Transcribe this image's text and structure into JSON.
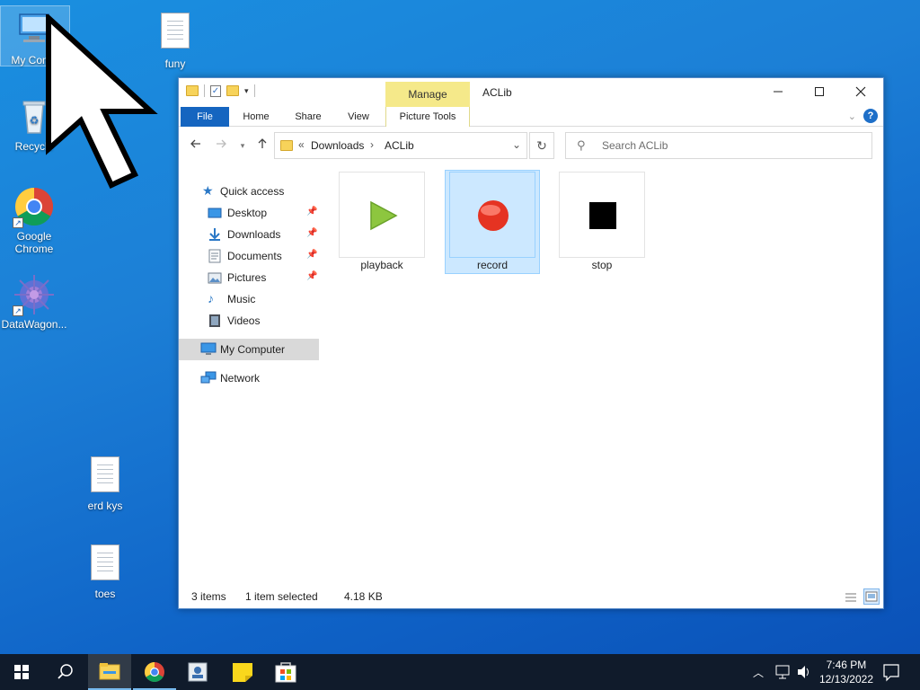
{
  "desktop": {
    "icons": [
      {
        "label": "My Computer",
        "display": "My Comp",
        "glyph": "computer-icon"
      },
      {
        "label": "funy",
        "glyph": "text-file-icon"
      },
      {
        "label": "Recycle Bin",
        "display": "Recycle",
        "glyph": "recycle-bin-icon"
      },
      {
        "label": "Google Chrome",
        "line1": "Google",
        "line2": "Chrome",
        "glyph": "chrome-icon"
      },
      {
        "label": "DataWagon...",
        "glyph": "datawagon-icon"
      },
      {
        "label": "erd kys",
        "glyph": "text-file-icon"
      },
      {
        "label": "toes",
        "glyph": "text-file-icon"
      }
    ]
  },
  "window": {
    "title": "ACLib",
    "manage_label": "Manage",
    "controls": {
      "minimize": "—",
      "maximize": "☐",
      "close": "✕"
    },
    "ribbon_tabs": [
      "File",
      "Home",
      "Share",
      "View",
      "Picture Tools"
    ],
    "address": {
      "prefix": "«",
      "crumbs": [
        "Downloads",
        "ACLib"
      ]
    },
    "search_placeholder": "Search ACLib",
    "nav_pane": {
      "quick_access": "Quick access",
      "items": [
        "Desktop",
        "Downloads",
        "Documents",
        "Pictures",
        "Music",
        "Videos"
      ],
      "my_computer": "My Computer",
      "network": "Network"
    },
    "files": [
      {
        "name": "playback",
        "selected": false,
        "icon": "play-icon"
      },
      {
        "name": "record",
        "selected": true,
        "icon": "record-icon"
      },
      {
        "name": "stop",
        "selected": false,
        "icon": "stop-icon"
      }
    ],
    "status": {
      "count": "3 items",
      "selection": "1 item selected",
      "size": "4.18 KB"
    }
  },
  "taskbar": {
    "apps": [
      "start-icon",
      "search-icon",
      "file-explorer-icon",
      "chrome-icon",
      "app-icon",
      "sticky-notes-icon",
      "store-icon"
    ],
    "time": "7:46 PM",
    "date": "12/13/2022"
  },
  "colors": {
    "accent": "#1565c0",
    "selection": "#cce8ff",
    "manage_tab": "#f5e98a",
    "taskbar": "#101b2b"
  }
}
